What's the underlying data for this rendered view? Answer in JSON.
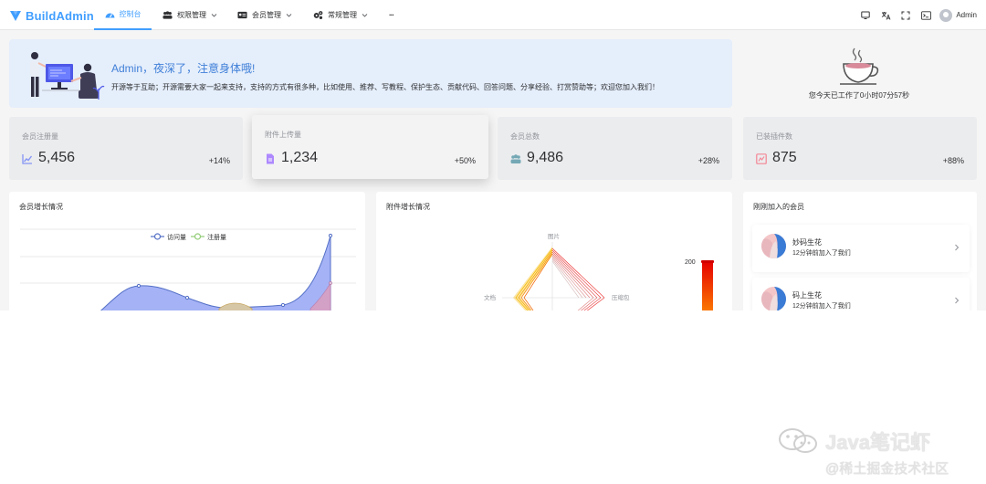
{
  "app": {
    "name": "BuildAdmin"
  },
  "nav": {
    "items": [
      {
        "label": "控制台",
        "icon": "dashboard-icon",
        "active": true
      },
      {
        "label": "权限管理",
        "icon": "users-icon",
        "dropdown": true
      },
      {
        "label": "会员管理",
        "icon": "id-card-icon",
        "dropdown": true
      },
      {
        "label": "常规管理",
        "icon": "cogs-icon",
        "dropdown": true
      },
      {
        "label": "···",
        "icon": "more-icon"
      }
    ],
    "tools": [
      "monitor-icon",
      "translate-icon",
      "fullscreen-icon",
      "terminal-icon"
    ],
    "user": "Admin"
  },
  "welcome": {
    "title": "Admin，夜深了，注意身体哦!",
    "desc": "开源等于互助；开源需要大家一起来支持，支持的方式有很多种，比如使用、推荐、写教程、保护生态、贡献代码、回答问题、分享经验、打赏赞助等；欢迎您加入我们！"
  },
  "worktime": {
    "text": "您今天已工作了0小时07分57秒"
  },
  "stats": [
    {
      "title": "会员注册量",
      "value": "5,456",
      "change": "+14%",
      "icon": "line-chart-icon",
      "color": "#8595f4"
    },
    {
      "title": "附件上传量",
      "value": "1,234",
      "change": "+50%",
      "icon": "file-icon",
      "color": "#ae89fe"
    },
    {
      "title": "会员总数",
      "value": "9,486",
      "change": "+28%",
      "icon": "users-icon",
      "color": "#74a8b5"
    },
    {
      "title": "已装插件数",
      "value": "875",
      "change": "+88%",
      "icon": "plugin-icon",
      "color": "#f48595"
    }
  ],
  "panels": {
    "member_growth": {
      "title": "会员增长情况",
      "legend": [
        "访问量",
        "注册量"
      ]
    },
    "attachment_growth": {
      "title": "附件增长情况",
      "labels": [
        "图片",
        "文档",
        "压缩包"
      ],
      "scale_max": "200"
    },
    "new_members": {
      "title": "刚刚加入的会员"
    }
  },
  "members": [
    {
      "name": "妙码生花",
      "time": "12分钟前加入了我们"
    },
    {
      "name": "码上生花",
      "time": "12分钟前加入了我们"
    }
  ],
  "watermark": {
    "line1": "Java笔记虾",
    "line2": "@稀土掘金技术社区"
  },
  "chart_data": {
    "type": "area",
    "title": "会员增长情况",
    "series": [
      {
        "name": "访问量",
        "color": "#5470c6"
      },
      {
        "name": "注册量",
        "color": "#91cc75"
      }
    ]
  }
}
